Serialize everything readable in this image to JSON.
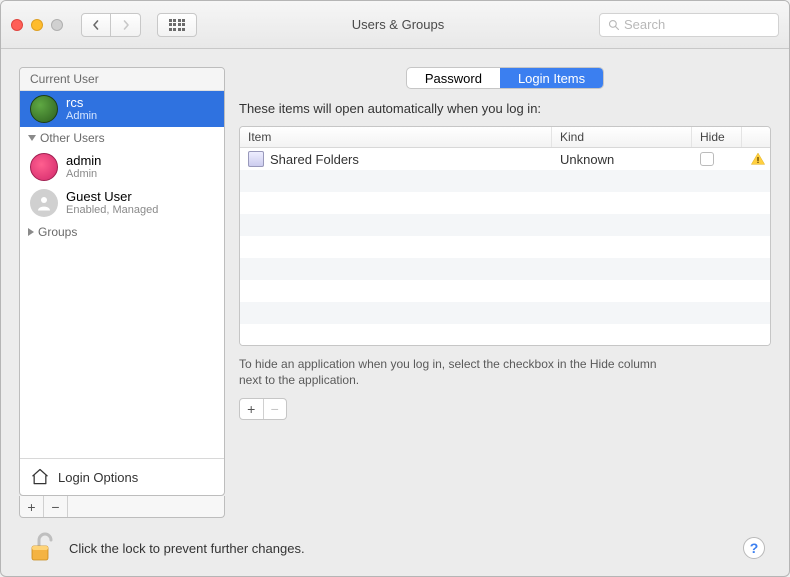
{
  "window": {
    "title": "Users & Groups"
  },
  "search": {
    "placeholder": "Search"
  },
  "sidebar": {
    "current_user_label": "Current User",
    "selected_user": {
      "name": "rcs",
      "role": "Admin"
    },
    "other_users_label": "Other Users",
    "other_users": [
      {
        "name": "admin",
        "role": "Admin"
      },
      {
        "name": "Guest User",
        "role": "Enabled, Managed"
      }
    ],
    "groups_label": "Groups",
    "login_options_label": "Login Options"
  },
  "tabs": {
    "password": "Password",
    "login_items": "Login Items"
  },
  "main": {
    "heading": "These items will open automatically when you log in:",
    "columns": {
      "item": "Item",
      "kind": "Kind",
      "hide": "Hide"
    },
    "rows": [
      {
        "name": "Shared Folders",
        "kind": "Unknown",
        "hide": false,
        "warning": true
      }
    ],
    "hint": "To hide an application when you log in, select the checkbox in the Hide column next to the application."
  },
  "footer": {
    "text": "Click the lock to prevent further changes."
  }
}
